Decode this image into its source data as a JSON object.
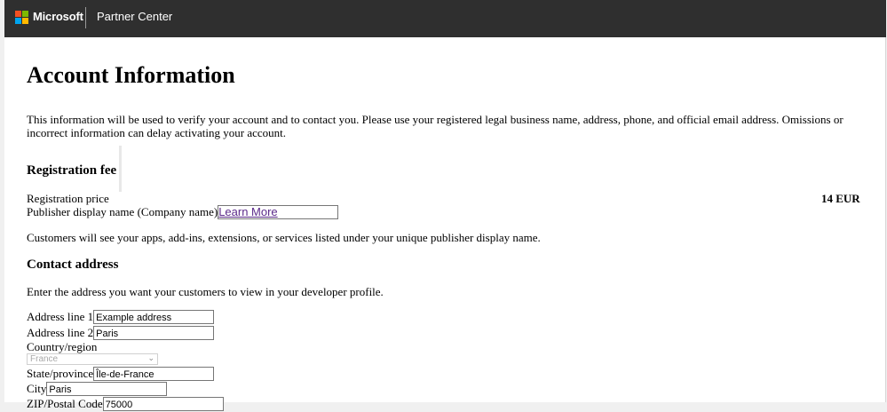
{
  "header": {
    "brand": "Microsoft",
    "app_name": "Partner Center",
    "logo_colors": [
      "#f25022",
      "#7fba00",
      "#00a4ef",
      "#ffb900"
    ]
  },
  "page": {
    "title": "Account Information",
    "intro": "This information will be used to verify your account and to contact you. Please use your registered legal business name, address, phone, and official email address. Omissions or incorrect information can delay activating your account."
  },
  "registration": {
    "heading": "Registration fee",
    "price_label": "Registration price",
    "price_value": "14 EUR",
    "publisher_label": "Publisher display name (Company name)",
    "learn_more": "Learn More",
    "publisher_value": "",
    "publisher_note": "Customers will see your apps, add-ins, extensions, or services listed under your unique publisher display name."
  },
  "contact": {
    "heading": "Contact address",
    "description": "Enter the address you want your customers to view in your developer profile.",
    "address1_label": "Address line 1",
    "address1_value": "Example address",
    "address2_label": "Address line 2",
    "address2_value": "Paris",
    "country_label": "Country/region",
    "country_value": "France",
    "state_label": "State/province",
    "state_value": "Île-de-France",
    "city_label": "City",
    "city_value": "Paris",
    "zip_label": "ZIP/Postal Code",
    "zip_value": "75000"
  }
}
